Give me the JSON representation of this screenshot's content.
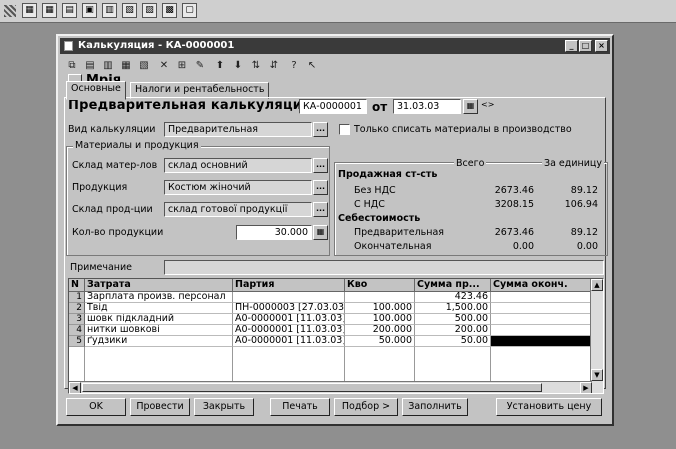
{
  "window": {
    "title": "Калькуляция - КА-0000001"
  },
  "tabs": [
    {
      "label": "Основные"
    },
    {
      "label": "Налоги и рентабельность"
    }
  ],
  "header": {
    "org_name": "Мрія",
    "doc_title": "Предварительная калькуляция",
    "doc_number": "КА-0000001",
    "from_label": "от",
    "doc_date": "31.03.03",
    "nav_glyph": "<>"
  },
  "calc_kind": {
    "label": "Вид калькуляции",
    "value": "Предварительная"
  },
  "write_off": {
    "label": "Только списать материалы в производство",
    "checked": false
  },
  "materials": {
    "group_title": "Материалы и продукция",
    "warehouse_label": "Склад матер-лов",
    "warehouse_value": "склад основний",
    "product_label": "Продукция",
    "product_value": "Костюм жіночий",
    "product_wh_label": "Склад прод-ции",
    "product_wh_value": "склад готової продукції",
    "qty_label": "Кол-во продукции",
    "qty_value": "30.000"
  },
  "sales": {
    "total_header": "Всего",
    "unit_header": "За единицу",
    "sale_cost_label": "Продажная ст-сть",
    "no_vat_label": "Без НДС",
    "no_vat_total": "2673.46",
    "no_vat_unit": "89.12",
    "with_vat_label": "С НДС",
    "with_vat_total": "3208.15",
    "with_vat_unit": "106.94",
    "cost_label": "Себестоимость",
    "prelim_label": "Предварительная",
    "prelim_total": "2673.46",
    "prelim_unit": "89.12",
    "final_label": "Окончательная",
    "final_total": "0.00",
    "final_unit": "0.00"
  },
  "note": {
    "label": "Примечание",
    "value": ""
  },
  "grid": {
    "columns": [
      "N",
      "Затрата",
      "Партия",
      "Кво",
      "Сумма пр...",
      "Сумма оконч."
    ],
    "rows": [
      {
        "n": "1",
        "cost": "Зарплата произв. персонал",
        "batch": "",
        "qty": "",
        "sum_pre": "423.46",
        "sum_final": ""
      },
      {
        "n": "2",
        "cost": "Твід",
        "batch": "ПН-0000003 [27.03.03]",
        "qty": "100.000",
        "sum_pre": "1,500.00",
        "sum_final": ""
      },
      {
        "n": "3",
        "cost": "шовк підкладний",
        "batch": "А0-0000001 [11.03.03]",
        "qty": "100.000",
        "sum_pre": "500.00",
        "sum_final": ""
      },
      {
        "n": "4",
        "cost": "нитки шовкові",
        "batch": "А0-0000001 [11.03.03]",
        "qty": "200.000",
        "sum_pre": "200.00",
        "sum_final": ""
      },
      {
        "n": "5",
        "cost": "ґудзики",
        "batch": "А0-0000001 [11.03.03]",
        "qty": "50.000",
        "sum_pre": "50.00",
        "sum_final": ""
      }
    ]
  },
  "buttons": {
    "ok": "OK",
    "post": "Провести",
    "close": "Закрыть",
    "print": "Печать",
    "select": "Подбор >",
    "fill": "Заполнить",
    "set_price": "Установить цену"
  },
  "colors": {
    "titlebar": "#3a3a3a",
    "window": "#c3c3c3",
    "desktop": "#8f8f8f"
  }
}
